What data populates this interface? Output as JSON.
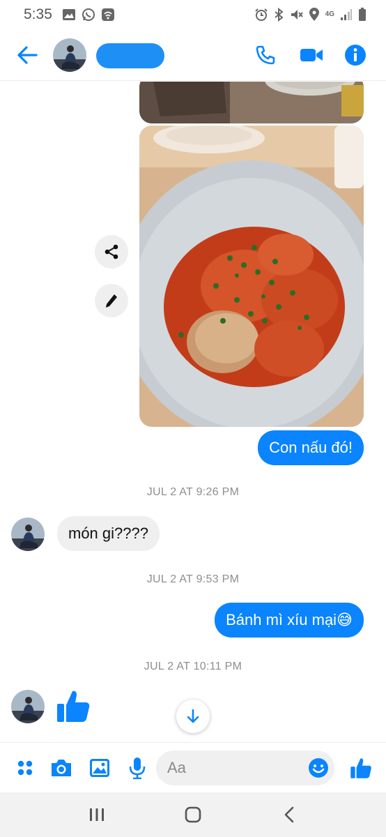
{
  "status_bar": {
    "time": "5:35",
    "network": "4G",
    "left_icons": [
      "image-notification-icon",
      "whatsapp-icon",
      "wifi-calling-icon"
    ],
    "right_icons": [
      "alarm-icon",
      "bluetooth-icon",
      "mute-icon",
      "location-icon",
      "signal-icon",
      "battery-icon"
    ]
  },
  "header": {
    "contact_name": "",
    "actions": [
      "phone-icon",
      "video-call-icon",
      "info-icon"
    ]
  },
  "chat": {
    "messages": [
      {
        "type": "photo",
        "direction": "outgoing",
        "description": "food photo (partial, top)"
      },
      {
        "type": "photo",
        "direction": "outgoing",
        "description": "meatballs in tomato sauce"
      },
      {
        "type": "text",
        "direction": "outgoing",
        "text": "Con nấu đó!"
      },
      {
        "type": "timestamp",
        "text": "JUL 2 AT 9:26 PM"
      },
      {
        "type": "text",
        "direction": "incoming",
        "text": "món gi????"
      },
      {
        "type": "timestamp",
        "text": "JUL 2 AT 9:53 PM"
      },
      {
        "type": "text",
        "direction": "outgoing",
        "text": "Bánh mì xíu mại😅"
      },
      {
        "type": "timestamp",
        "text": "JUL 2 AT 10:11 PM"
      },
      {
        "type": "like",
        "direction": "incoming"
      }
    ]
  },
  "composer": {
    "placeholder": "Aa",
    "value": ""
  },
  "colors": {
    "accent": "#0a84ff",
    "incoming_bubble": "#efefef",
    "timestamp": "#8e8e8e"
  }
}
